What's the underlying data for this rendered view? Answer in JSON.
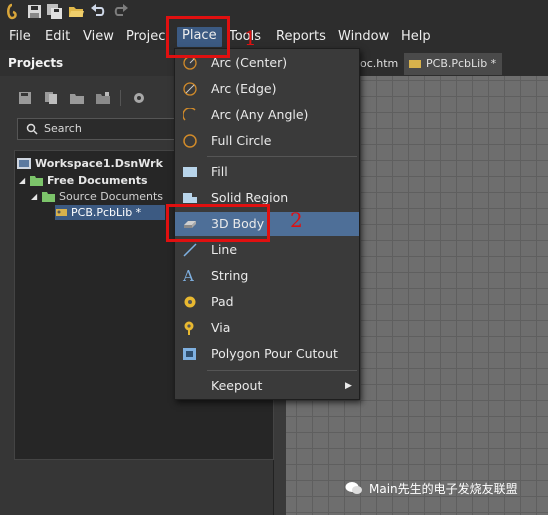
{
  "toolbar": {
    "icons": [
      "app-logo-icon",
      "save-icon",
      "save-all-icon",
      "open-folder-icon",
      "undo-icon",
      "redo-icon"
    ]
  },
  "menubar": {
    "items": [
      {
        "label": "File"
      },
      {
        "label": "Edit"
      },
      {
        "label": "View"
      },
      {
        "label": "Projec"
      },
      {
        "label": "Place"
      },
      {
        "label": "Tools"
      },
      {
        "label": "Reports"
      },
      {
        "label": "Window"
      },
      {
        "label": "Help"
      }
    ]
  },
  "panel": {
    "title": "Projects",
    "search_placeholder": "Search",
    "tree": [
      {
        "label": "Workspace1.DsnWrk"
      },
      {
        "label": "Free Documents"
      },
      {
        "label": "Source Documents"
      },
      {
        "label": "PCB.PcbLib *"
      }
    ]
  },
  "tabs": [
    {
      "label": "oc.htm"
    },
    {
      "label": "PCB.PcbLib *"
    }
  ],
  "place_menu": {
    "items": [
      {
        "label": "Arc (Center)",
        "icon": "arc-center-icon"
      },
      {
        "label": "Arc (Edge)",
        "icon": "arc-edge-icon"
      },
      {
        "label": "Arc (Any Angle)",
        "icon": "arc-any-angle-icon"
      },
      {
        "label": "Full Circle",
        "icon": "full-circle-icon"
      },
      {
        "label": "Fill",
        "icon": "fill-icon"
      },
      {
        "label": "Solid Region",
        "icon": "solid-region-icon"
      },
      {
        "label": "3D Body",
        "icon": "3d-body-icon"
      },
      {
        "label": "Line",
        "icon": "line-icon"
      },
      {
        "label": "String",
        "icon": "string-icon"
      },
      {
        "label": "Pad",
        "icon": "pad-icon"
      },
      {
        "label": "Via",
        "icon": "via-icon"
      },
      {
        "label": "Polygon Pour Cutout",
        "icon": "polygon-cutout-icon"
      },
      {
        "label": "Keepout",
        "icon": "submenu-arrow-icon"
      }
    ]
  },
  "annotations": {
    "step1": "1",
    "step2": "2"
  },
  "watermark": "Main先生的电子发烧友联盟",
  "colors": {
    "highlight": "#4e6f98",
    "annotation_red": "#e01010",
    "canvas": "#6e6e6e"
  }
}
